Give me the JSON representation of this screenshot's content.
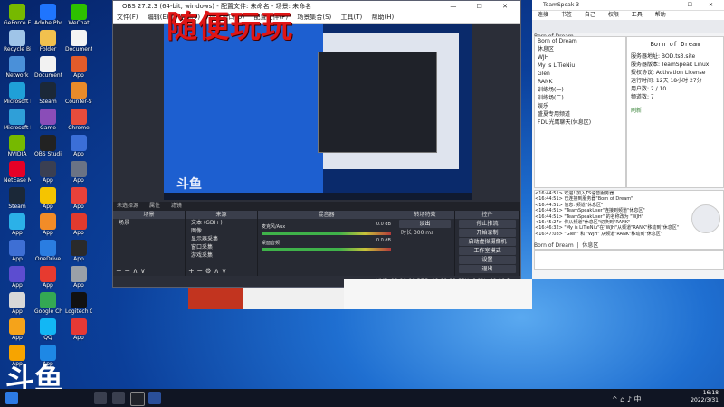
{
  "desktop_icons": [
    {
      "label": "GeForce Experience",
      "color": "#76b900"
    },
    {
      "label": "Adobe Photoshop",
      "color": "#1f75fe"
    },
    {
      "label": "WeChat",
      "color": "#2dc100"
    },
    {
      "label": "Recycle Bin",
      "color": "#9fc4e8"
    },
    {
      "label": "Folder",
      "color": "#f2c14e"
    },
    {
      "label": "Document",
      "color": "#f4f4f4"
    },
    {
      "label": "Network",
      "color": "#4a90d9"
    },
    {
      "label": "Documents",
      "color": "#f2f2f2"
    },
    {
      "label": "App",
      "color": "#e25b2a"
    },
    {
      "label": "Microsoft Edge",
      "color": "#1fa0d8"
    },
    {
      "label": "Steam",
      "color": "#1b2838"
    },
    {
      "label": "Counter-Strike",
      "color": "#e98b2a"
    },
    {
      "label": "Microsoft Edge",
      "color": "#2f9fd8"
    },
    {
      "label": "Game",
      "color": "#8a4db8"
    },
    {
      "label": "Chrome",
      "color": "#e74c3c"
    },
    {
      "label": "NVIDIA",
      "color": "#76b900"
    },
    {
      "label": "OBS Studio",
      "color": "#222"
    },
    {
      "label": "App",
      "color": "#3b6fd8"
    },
    {
      "label": "NetEase Music",
      "color": "#e60026"
    },
    {
      "label": "App",
      "color": "#3a3f52"
    },
    {
      "label": "App",
      "color": "#6a7385"
    },
    {
      "label": "Steam",
      "color": "#1b2838"
    },
    {
      "label": "App",
      "color": "#f5c400"
    },
    {
      "label": "App",
      "color": "#e8413a"
    },
    {
      "label": "App",
      "color": "#2bb1e8"
    },
    {
      "label": "App",
      "color": "#f28c28"
    },
    {
      "label": "App",
      "color": "#e23a2e"
    },
    {
      "label": "App",
      "color": "#3e6fd4"
    },
    {
      "label": "OneDrive",
      "color": "#2a7de1"
    },
    {
      "label": "App",
      "color": "#2a2a2a"
    },
    {
      "label": "App",
      "color": "#5c4dd0"
    },
    {
      "label": "App",
      "color": "#e73a2f"
    },
    {
      "label": "App",
      "color": "#9aa0a8"
    },
    {
      "label": "App",
      "color": "#d8d8d8"
    },
    {
      "label": "Google Chrome",
      "color": "#34a853"
    },
    {
      "label": "Logitech G HUB",
      "color": "#111"
    },
    {
      "label": "App",
      "color": "#f5a31a"
    },
    {
      "label": "QQ",
      "color": "#12b7f5"
    },
    {
      "label": "App",
      "color": "#e53935"
    },
    {
      "label": "App",
      "color": "#f7a400"
    },
    {
      "label": "App",
      "color": "#1e88e5"
    }
  ],
  "obs": {
    "title": "OBS 27.2.3 (64-bit, windows) - 配置文件: 未命名 - 场景: 未命名",
    "window_controls": "— ☐ ✕",
    "menu": [
      "文件(F)",
      "编辑(E)",
      "视图(V)",
      "停靠窗口(D)",
      "配置文件(P)",
      "场景集合(S)",
      "工具(T)",
      "帮助(H)"
    ],
    "preview_watermark": "斗鱼",
    "toolbar": [
      "未选择源",
      "属性",
      "滤镜"
    ],
    "docks": {
      "scenes": {
        "header": "场景",
        "items": [
          "场景"
        ]
      },
      "sources": {
        "header": "来源",
        "items": [
          "文本 (GDI+)",
          "图像",
          "显示器采集",
          "窗口采集",
          "游戏采集",
          "显示器采集"
        ]
      },
      "mixer": {
        "header": "混音器",
        "rows": [
          {
            "name": "麦克风/Aux",
            "level": "0.0 dB"
          },
          {
            "name": "桌面音频",
            "level": "0.0 dB"
          }
        ]
      },
      "transitions": {
        "header": "转场特效",
        "type": "淡出",
        "duration_label": "时长",
        "duration": "300 ms"
      },
      "controls": {
        "header": "控件",
        "buttons": [
          "停止推流",
          "开始录制",
          "启动虚拟摄像机",
          "工作室模式",
          "设置",
          "退出"
        ]
      }
    },
    "status": "LIVE: 00:00:06   REC: 00:00:00   CPU: 6.9%, 60.00 fps"
  },
  "overlay_title": "随便玩玩",
  "teamspeak": {
    "title": "TeamSpeak 3",
    "window_controls": "— ☐ ✕",
    "menu": [
      "连接",
      "书签",
      "自己",
      "权限",
      "工具",
      "帮助"
    ],
    "server_tab": "Born of Dream",
    "tree": [
      "Born of Dream",
      "  休息区",
      "    WJH",
      "    My is LiTieNiu",
      "    Glen",
      "  RANK",
      "  训练场(一)",
      "  训练场(二)",
      "  娱乐",
      "    盛夏专用频道",
      "  FDU光鹰聊天(休息区)"
    ],
    "info_title": "Born of Dream",
    "info_rows": [
      [
        "服务器地址:",
        "BOD.ts3.site"
      ],
      [
        "服务器版本:",
        "TeamSpeak Linux"
      ],
      [
        "授权协议:",
        "Activation License"
      ],
      [
        "运行时间:",
        "12天 18小时 27分"
      ],
      [
        "用户数:",
        "2 / 10"
      ],
      [
        "频道数:",
        "7"
      ]
    ],
    "info_link": "刷新",
    "chat_lines": [
      "<16:44:51> 欢迎! 加入TS语音服务器",
      "<16:44:51> 已连接到服务器\"Born of Dream\"",
      "<16:44:51> 信息: 频道\"休息区\"",
      "<16:44:51> \"TeamSpeakUser\"连接到频道\"休息区\"",
      "<16:44:51> \"TeamSpeakUser\" 的名称改为 \"WJH\"",
      "<16:45:27> 你从频道\"休息区\"切换到\"RANK\"",
      "<16:46:32> \"My is LiTieNiu\"在\"WJH\"从频道\"RANK\"移动到\"休息区\"",
      "<16:47:08> \"Glen\" 和 \"WJH\" 从频道\"RANK\"移动到\"休息区\""
    ],
    "chat_tabs": [
      "Born of Dream",
      "休息区"
    ]
  },
  "panel2_text": "",
  "bottom_watermark": "斗鱼",
  "taskbar": {
    "time": "16:18",
    "date": "2022/3/31",
    "tray": "^ ⌂ ♪ 中"
  }
}
